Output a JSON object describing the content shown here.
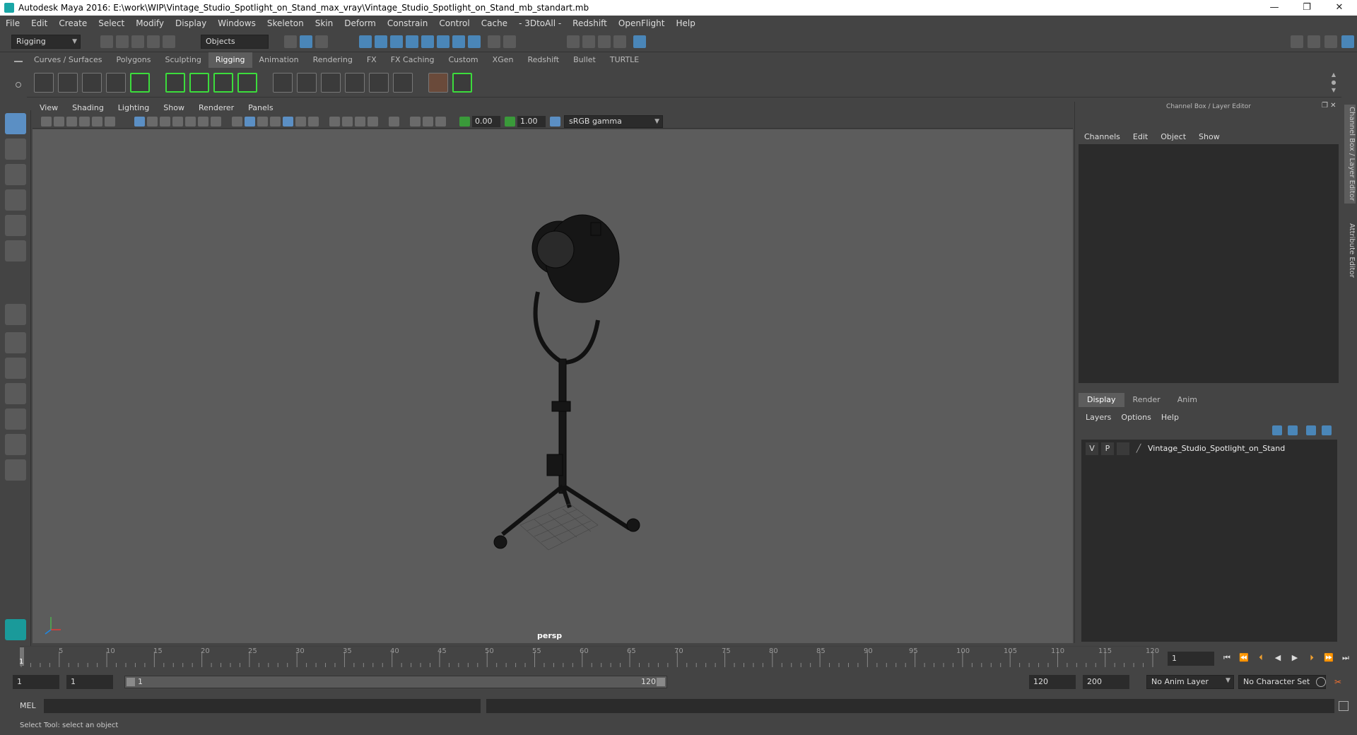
{
  "window": {
    "title": "Autodesk Maya 2016: E:\\work\\WIP\\Vintage_Studio_Spotlight_on_Stand_max_vray\\Vintage_Studio_Spotlight_on_Stand_mb_standart.mb",
    "minimize": "—",
    "restore": "❐",
    "close": "✕"
  },
  "menubar": [
    "File",
    "Edit",
    "Create",
    "Select",
    "Modify",
    "Display",
    "Windows",
    "Skeleton",
    "Skin",
    "Deform",
    "Constrain",
    "Control",
    "Cache",
    "- 3DtoAll -",
    "Redshift",
    "OpenFlight",
    "Help"
  ],
  "statusline": {
    "menuset": "Rigging",
    "selection_mode": "Objects"
  },
  "shelf_tabs": [
    "Curves / Surfaces",
    "Polygons",
    "Sculpting",
    "Rigging",
    "Animation",
    "Rendering",
    "FX",
    "FX Caching",
    "Custom",
    "XGen",
    "Redshift",
    "Bullet",
    "TURTLE"
  ],
  "active_shelf_tab": "Rigging",
  "viewport": {
    "menu": [
      "View",
      "Shading",
      "Lighting",
      "Show",
      "Renderer",
      "Panels"
    ],
    "exposure": "0.00",
    "gamma": "1.00",
    "color_space": "sRGB gamma",
    "camera_label": "persp"
  },
  "channel_box": {
    "title": "Channel Box / Layer Editor",
    "menu": [
      "Channels",
      "Edit",
      "Object",
      "Show"
    ]
  },
  "layer_editor": {
    "tabs": [
      "Display",
      "Render",
      "Anim"
    ],
    "active_tab": "Display",
    "menu": [
      "Layers",
      "Options",
      "Help"
    ],
    "layers": [
      {
        "v": "V",
        "p": "P",
        "name": "Vintage_Studio_Spotlight_on_Stand"
      }
    ]
  },
  "side_tabs": [
    "Channel Box / Layer Editor",
    "Attribute Editor"
  ],
  "timeline": {
    "ticks": [
      "5",
      "10",
      "15",
      "20",
      "25",
      "30",
      "35",
      "40",
      "45",
      "50",
      "55",
      "60",
      "65",
      "70",
      "75",
      "80",
      "85",
      "90",
      "95",
      "100",
      "105",
      "110",
      "115",
      "120"
    ],
    "current_marker": "1",
    "current_frame": "1"
  },
  "range": {
    "start": "1",
    "playback_start": "1",
    "slider_start": "1",
    "slider_end": "120",
    "playback_end": "120",
    "end": "200",
    "anim_layer": "No Anim Layer",
    "character_set": "No Character Set"
  },
  "command_line": {
    "label": "MEL"
  },
  "help_line": "Select Tool: select an object"
}
